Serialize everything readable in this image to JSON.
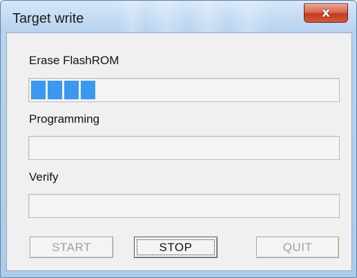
{
  "window": {
    "title": "Target write",
    "close_glyph": "x"
  },
  "sections": [
    {
      "label": "Erase FlashROM",
      "progress_segments": 4
    },
    {
      "label": "Programming",
      "progress_segments": 0
    },
    {
      "label": "Verify",
      "progress_segments": 0
    }
  ],
  "buttons": {
    "start_label": "START",
    "stop_label": "STOP",
    "quit_label": "QUIT"
  },
  "colors": {
    "progress_fill": "#3a98ee",
    "close_button": "#c13b1f"
  }
}
